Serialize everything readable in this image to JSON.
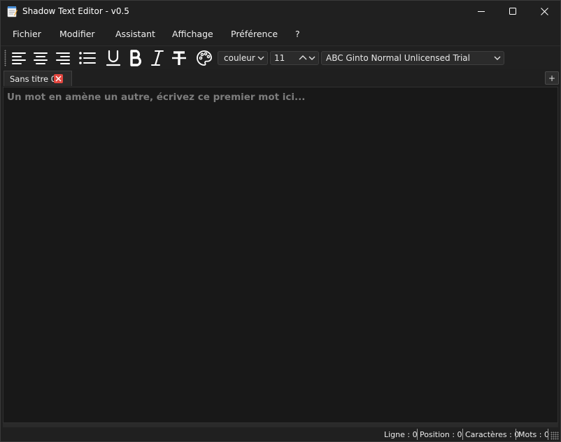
{
  "window": {
    "title": "Shadow Text Editor - v0.5"
  },
  "menu": {
    "items": [
      "Fichier",
      "Modifier",
      "Assistant",
      "Affichage",
      "Préférence",
      "?"
    ]
  },
  "toolbar": {
    "icons": [
      "align-left-icon",
      "align-center-icon",
      "align-right-icon",
      "bullet-list-icon",
      "underline-icon",
      "bold-icon",
      "italic-icon",
      "strikethrough-icon",
      "palette-icon"
    ],
    "color_select": "couleur",
    "font_size": "11",
    "font_family": "ABC Ginto Normal Unlicensed Trial"
  },
  "tabs": [
    {
      "label": "Sans titre 0"
    }
  ],
  "add_tab_label": "+",
  "editor": {
    "placeholder": "Un mot en amène un autre, écrivez ce premier mot ici...",
    "value": ""
  },
  "status": {
    "line": "Ligne : 0",
    "position": "Position : 0",
    "characters": "Caractères : 0",
    "words": "Mots : 0"
  },
  "colors": {
    "background": "#202020",
    "editor_bg": "#181818",
    "tab_close": "#e2463f"
  }
}
